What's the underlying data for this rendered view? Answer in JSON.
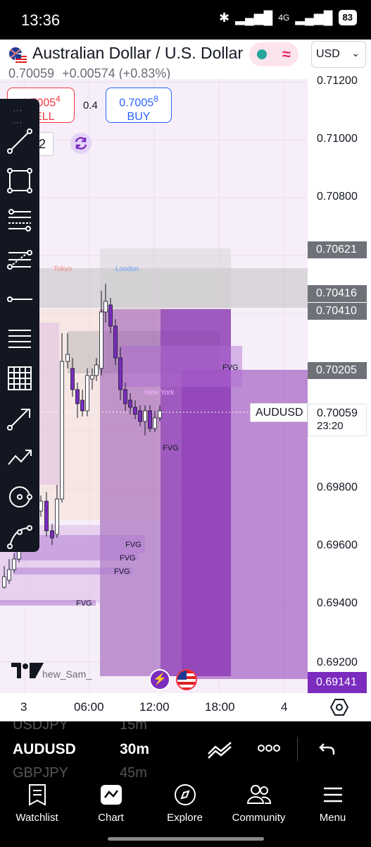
{
  "status_bar": {
    "time": "13:36",
    "network": "4G",
    "battery": "83"
  },
  "header": {
    "title": "Australian Dollar / U.S. Dollar",
    "price": "0.70059",
    "change": "+0.00574",
    "change_pct": "(+0.83%)",
    "currency": "USD"
  },
  "trade": {
    "sell_price_main": "0.7005",
    "sell_price_small": "4",
    "sell_label": "SELL",
    "buy_price_main": "0.7005",
    "buy_price_small": "8",
    "buy_label": "BUY",
    "spread": "0.4",
    "quantity": "2"
  },
  "price_axis": {
    "ticks": [
      "0.71200",
      "0.71000",
      "0.70800",
      "0.69800",
      "0.69600",
      "0.69400",
      "0.69200"
    ],
    "tags": [
      "0.70621",
      "0.70416",
      "0.70410",
      "0.70205"
    ],
    "low_tag": "0.69141",
    "current_price": "0.70059",
    "countdown": "23:20",
    "symbol_label": "AUDUSD"
  },
  "time_axis": {
    "labels": [
      "3",
      "06:00",
      "12:00",
      "18:00",
      "4"
    ]
  },
  "chart": {
    "session_labels": [
      "Tokyo",
      "London",
      "New York"
    ],
    "fvg_label": "FVG",
    "watermark": "hew_Sam_"
  },
  "toolbar": {
    "tools": [
      "trend-line",
      "rectangle",
      "fib-retracement",
      "pitchfork",
      "horizontal-ray",
      "parallel-channel",
      "gann-grid",
      "arrow",
      "path",
      "circle",
      "curve"
    ]
  },
  "symbol_strip": {
    "prev_symbol": "USDJPY",
    "prev_interval": "15m",
    "symbol": "AUDUSD",
    "interval": "30m",
    "next_symbol": "GBPJPY",
    "next_interval": "45m"
  },
  "bottom_nav": {
    "items": [
      "Watchlist",
      "Chart",
      "Explore",
      "Community",
      "Menu"
    ]
  },
  "colors": {
    "up": "#ffffff",
    "down": "#7b2cbf",
    "fvg": "#9c4dcc",
    "sell": "#f23645",
    "buy": "#2962ff"
  }
}
